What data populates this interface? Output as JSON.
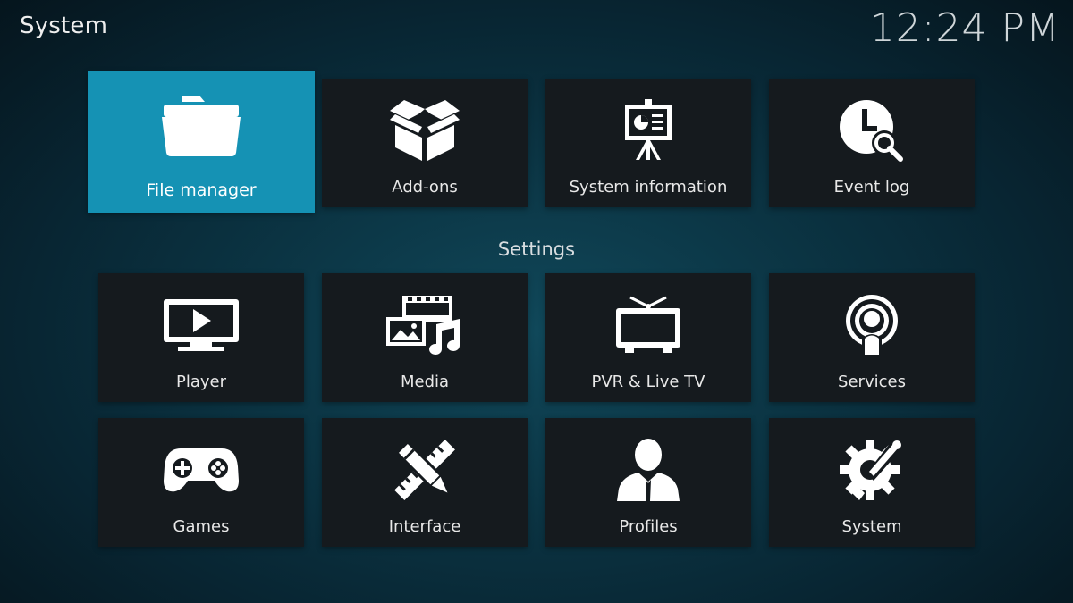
{
  "header": {
    "title": "System",
    "clock": "12:24 PM"
  },
  "top_row": [
    {
      "label": "File manager",
      "icon": "folder-icon",
      "focused": true
    },
    {
      "label": "Add-ons",
      "icon": "box-icon"
    },
    {
      "label": "System information",
      "icon": "presentation-board-icon"
    },
    {
      "label": "Event log",
      "icon": "clock-search-icon"
    }
  ],
  "settings": {
    "heading": "Settings",
    "items": [
      {
        "label": "Player",
        "icon": "tv-play-icon"
      },
      {
        "label": "Media",
        "icon": "media-library-icon"
      },
      {
        "label": "PVR & Live TV",
        "icon": "tv-antenna-icon"
      },
      {
        "label": "Services",
        "icon": "broadcast-icon"
      },
      {
        "label": "Games",
        "icon": "gamepad-icon"
      },
      {
        "label": "Interface",
        "icon": "pencil-ruler-icon"
      },
      {
        "label": "Profiles",
        "icon": "user-icon"
      },
      {
        "label": "System",
        "icon": "gear-wrench-icon"
      }
    ]
  },
  "colors": {
    "focus": "#1592b4",
    "tile": "#151a1e",
    "background": "#0b3443"
  }
}
